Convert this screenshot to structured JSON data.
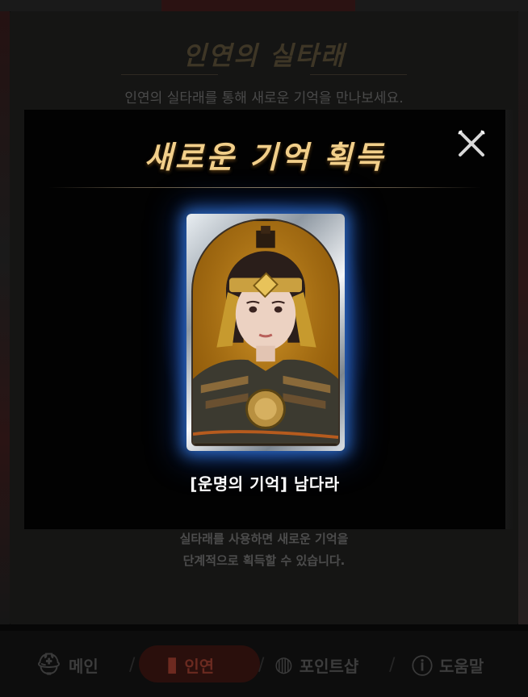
{
  "background": {
    "title": "인연의 실타래",
    "subtitle": "인연의 실타래를 통해 새로운 기억을 만나보세요.",
    "note_line1": "실타래를 사용하면 새로운 기억을",
    "note_line2": "단계적으로 획득할 수 있습니다."
  },
  "modal": {
    "title": "새로운 기억 획득",
    "card_name": "[운명의 기억] 남다라"
  },
  "bottom_nav": {
    "items": [
      {
        "label": "메인",
        "icon": "helmet-icon"
      },
      {
        "label": "인연",
        "icon": "book-icon",
        "active": true
      },
      {
        "label": "포인트샵",
        "icon": "point-coin-icon"
      },
      {
        "label": "도움말",
        "icon": "question-icon"
      }
    ]
  },
  "colors": {
    "modal_title": "#f2cf8a",
    "card_glow": "#3c8cff",
    "active_nav": "#6a2a20"
  }
}
